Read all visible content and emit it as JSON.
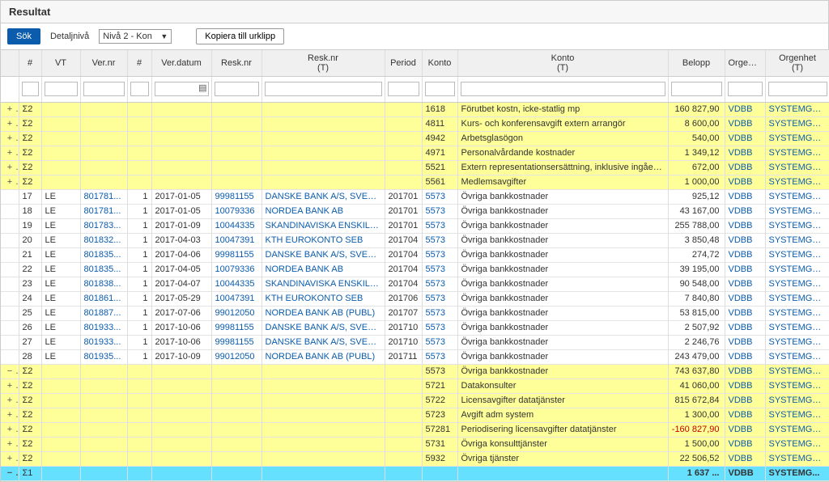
{
  "header": {
    "title": "Resultat"
  },
  "toolbar": {
    "search_label": "Sök",
    "detail_label": "Detaljnivå",
    "level_selected": "Nivå 2 - Kon",
    "copy_label": "Kopiera till urklipp"
  },
  "columns": {
    "exp": "",
    "sigma": "#",
    "vt": "VT",
    "vernr": "Ver.nr",
    "hash": "#",
    "verdatum": "Ver.datum",
    "resknr": "Resk.nr",
    "resknr_t": "Resk.nr\n(T)",
    "period": "Period",
    "konto": "Konto",
    "konto_t": "Konto\n(T)",
    "belopp": "Belopp",
    "orgenhet": "Orgenhet",
    "orgenhet_t": "Orgenhet\n(T)"
  },
  "sum_rows_top": [
    {
      "exp": "+",
      "sigma": "Σ2",
      "konto": "1618",
      "konto_t": "Förutbet kostn, icke-statlig mp",
      "belopp": "160 827,90",
      "org": "VDBB",
      "orgt": "SYSTEMGRUP..."
    },
    {
      "exp": "+",
      "sigma": "Σ2",
      "konto": "4811",
      "konto_t": "Kurs- och konferensavgift extern arrangör",
      "belopp": "8 600,00",
      "org": "VDBB",
      "orgt": "SYSTEMGRUP..."
    },
    {
      "exp": "+",
      "sigma": "Σ2",
      "konto": "4942",
      "konto_t": "Arbetsglasögon",
      "belopp": "540,00",
      "org": "VDBB",
      "orgt": "SYSTEMGRUP..."
    },
    {
      "exp": "+",
      "sigma": "Σ2",
      "konto": "4971",
      "konto_t": "Personalvårdande kostnader",
      "belopp": "1 349,12",
      "org": "VDBB",
      "orgt": "SYSTEMGRUP..."
    },
    {
      "exp": "+",
      "sigma": "Σ2",
      "konto": "5521",
      "konto_t": "Extern representationsersättning, inklusive ingående mo...",
      "belopp": "672,00",
      "org": "VDBB",
      "orgt": "SYSTEMGRUP..."
    },
    {
      "exp": "+",
      "sigma": "Σ2",
      "konto": "5561",
      "konto_t": "Medlemsavgifter",
      "belopp": "1 000,00",
      "org": "VDBB",
      "orgt": "SYSTEMGRUP..."
    }
  ],
  "detail_rows": [
    {
      "n": "17",
      "vt": "LE",
      "vernr": "801781...",
      "hash": "1",
      "date": "2017-01-05",
      "resk": "99981155",
      "reskt": "DANSKE BANK A/S, SVERIGE FIL...",
      "period": "201701",
      "konto": "5573",
      "kontot": "Övriga bankkostnader",
      "belopp": "925,12",
      "org": "VDBB",
      "orgt": "SYSTEMGRUP..."
    },
    {
      "n": "18",
      "vt": "LE",
      "vernr": "801781...",
      "hash": "1",
      "date": "2017-01-05",
      "resk": "10079336",
      "reskt": "NORDEA BANK AB",
      "period": "201701",
      "konto": "5573",
      "kontot": "Övriga bankkostnader",
      "belopp": "43 167,00",
      "org": "VDBB",
      "orgt": "SYSTEMGRUP..."
    },
    {
      "n": "19",
      "vt": "LE",
      "vernr": "801783...",
      "hash": "1",
      "date": "2017-01-09",
      "resk": "10044335",
      "reskt": "SKANDINAVISKA ENSKILDA BAN...",
      "period": "201701",
      "konto": "5573",
      "kontot": "Övriga bankkostnader",
      "belopp": "255 788,00",
      "org": "VDBB",
      "orgt": "SYSTEMGRUP..."
    },
    {
      "n": "20",
      "vt": "LE",
      "vernr": "801832...",
      "hash": "1",
      "date": "2017-04-03",
      "resk": "10047391",
      "reskt": "KTH EUROKONTO SEB",
      "period": "201704",
      "konto": "5573",
      "kontot": "Övriga bankkostnader",
      "belopp": "3 850,48",
      "org": "VDBB",
      "orgt": "SYSTEMGRUP..."
    },
    {
      "n": "21",
      "vt": "LE",
      "vernr": "801835...",
      "hash": "1",
      "date": "2017-04-06",
      "resk": "99981155",
      "reskt": "DANSKE BANK A/S, SVERIGE FIL...",
      "period": "201704",
      "konto": "5573",
      "kontot": "Övriga bankkostnader",
      "belopp": "274,72",
      "org": "VDBB",
      "orgt": "SYSTEMGRUP..."
    },
    {
      "n": "22",
      "vt": "LE",
      "vernr": "801835...",
      "hash": "1",
      "date": "2017-04-05",
      "resk": "10079336",
      "reskt": "NORDEA BANK AB",
      "period": "201704",
      "konto": "5573",
      "kontot": "Övriga bankkostnader",
      "belopp": "39 195,00",
      "org": "VDBB",
      "orgt": "SYSTEMGRUP..."
    },
    {
      "n": "23",
      "vt": "LE",
      "vernr": "801838...",
      "hash": "1",
      "date": "2017-04-07",
      "resk": "10044335",
      "reskt": "SKANDINAVISKA ENSKILDA BAN...",
      "period": "201704",
      "konto": "5573",
      "kontot": "Övriga bankkostnader",
      "belopp": "90 548,00",
      "org": "VDBB",
      "orgt": "SYSTEMGRUP..."
    },
    {
      "n": "24",
      "vt": "LE",
      "vernr": "801861...",
      "hash": "1",
      "date": "2017-05-29",
      "resk": "10047391",
      "reskt": "KTH EUROKONTO SEB",
      "period": "201706",
      "konto": "5573",
      "kontot": "Övriga bankkostnader",
      "belopp": "7 840,80",
      "org": "VDBB",
      "orgt": "SYSTEMGRUP..."
    },
    {
      "n": "25",
      "vt": "LE",
      "vernr": "801887...",
      "hash": "1",
      "date": "2017-07-06",
      "resk": "99012050",
      "reskt": "NORDEA BANK AB (PUBL)",
      "period": "201707",
      "konto": "5573",
      "kontot": "Övriga bankkostnader",
      "belopp": "53 815,00",
      "org": "VDBB",
      "orgt": "SYSTEMGRUP..."
    },
    {
      "n": "26",
      "vt": "LE",
      "vernr": "801933...",
      "hash": "1",
      "date": "2017-10-06",
      "resk": "99981155",
      "reskt": "DANSKE BANK A/S, SVERIGE FIL...",
      "period": "201710",
      "konto": "5573",
      "kontot": "Övriga bankkostnader",
      "belopp": "2 507,92",
      "org": "VDBB",
      "orgt": "SYSTEMGRUP..."
    },
    {
      "n": "27",
      "vt": "LE",
      "vernr": "801933...",
      "hash": "1",
      "date": "2017-10-06",
      "resk": "99981155",
      "reskt": "DANSKE BANK A/S, SVERIGE FIL...",
      "period": "201710",
      "konto": "5573",
      "kontot": "Övriga bankkostnader",
      "belopp": "2 246,76",
      "org": "VDBB",
      "orgt": "SYSTEMGRUP..."
    },
    {
      "n": "28",
      "vt": "LE",
      "vernr": "801935...",
      "hash": "1",
      "date": "2017-10-09",
      "resk": "99012050",
      "reskt": "NORDEA BANK AB (PUBL)",
      "period": "201711",
      "konto": "5573",
      "kontot": "Övriga bankkostnader",
      "belopp": "243 479,00",
      "org": "VDBB",
      "orgt": "SYSTEMGRUP..."
    }
  ],
  "sum_rows_bottom": [
    {
      "exp": "−",
      "sigma": "Σ2",
      "konto": "5573",
      "konto_t": "Övriga bankkostnader",
      "belopp": "743 637,80",
      "neg": false,
      "org": "VDBB",
      "orgt": "SYSTEMGRUP..."
    },
    {
      "exp": "+",
      "sigma": "Σ2",
      "konto": "5721",
      "konto_t": "Datakonsulter",
      "belopp": "41 060,00",
      "neg": false,
      "org": "VDBB",
      "orgt": "SYSTEMGRUP..."
    },
    {
      "exp": "+",
      "sigma": "Σ2",
      "konto": "5722",
      "konto_t": "Licensavgifter datatjänster",
      "belopp": "815 672,84",
      "neg": false,
      "org": "VDBB",
      "orgt": "SYSTEMGRUP..."
    },
    {
      "exp": "+",
      "sigma": "Σ2",
      "konto": "5723",
      "konto_t": "Avgift adm system",
      "belopp": "1 300,00",
      "neg": false,
      "org": "VDBB",
      "orgt": "SYSTEMGRUP..."
    },
    {
      "exp": "+",
      "sigma": "Σ2",
      "konto": "57281",
      "konto_t": "Periodisering licensavgifter datatjänster",
      "belopp": "-160 827,90",
      "neg": true,
      "org": "VDBB",
      "orgt": "SYSTEMGRUP..."
    },
    {
      "exp": "+",
      "sigma": "Σ2",
      "konto": "5731",
      "konto_t": "Övriga konsulttjänster",
      "belopp": "1 500,00",
      "neg": false,
      "org": "VDBB",
      "orgt": "SYSTEMGRUP..."
    },
    {
      "exp": "+",
      "sigma": "Σ2",
      "konto": "5932",
      "konto_t": "Övriga tjänster",
      "belopp": "22 506,52",
      "neg": false,
      "org": "VDBB",
      "orgt": "SYSTEMGRUP..."
    }
  ],
  "grand_total": {
    "exp": "−",
    "sigma": "Σ1",
    "belopp": "1 637 ...",
    "org": "VDBB",
    "orgt": "SYSTEMG..."
  }
}
